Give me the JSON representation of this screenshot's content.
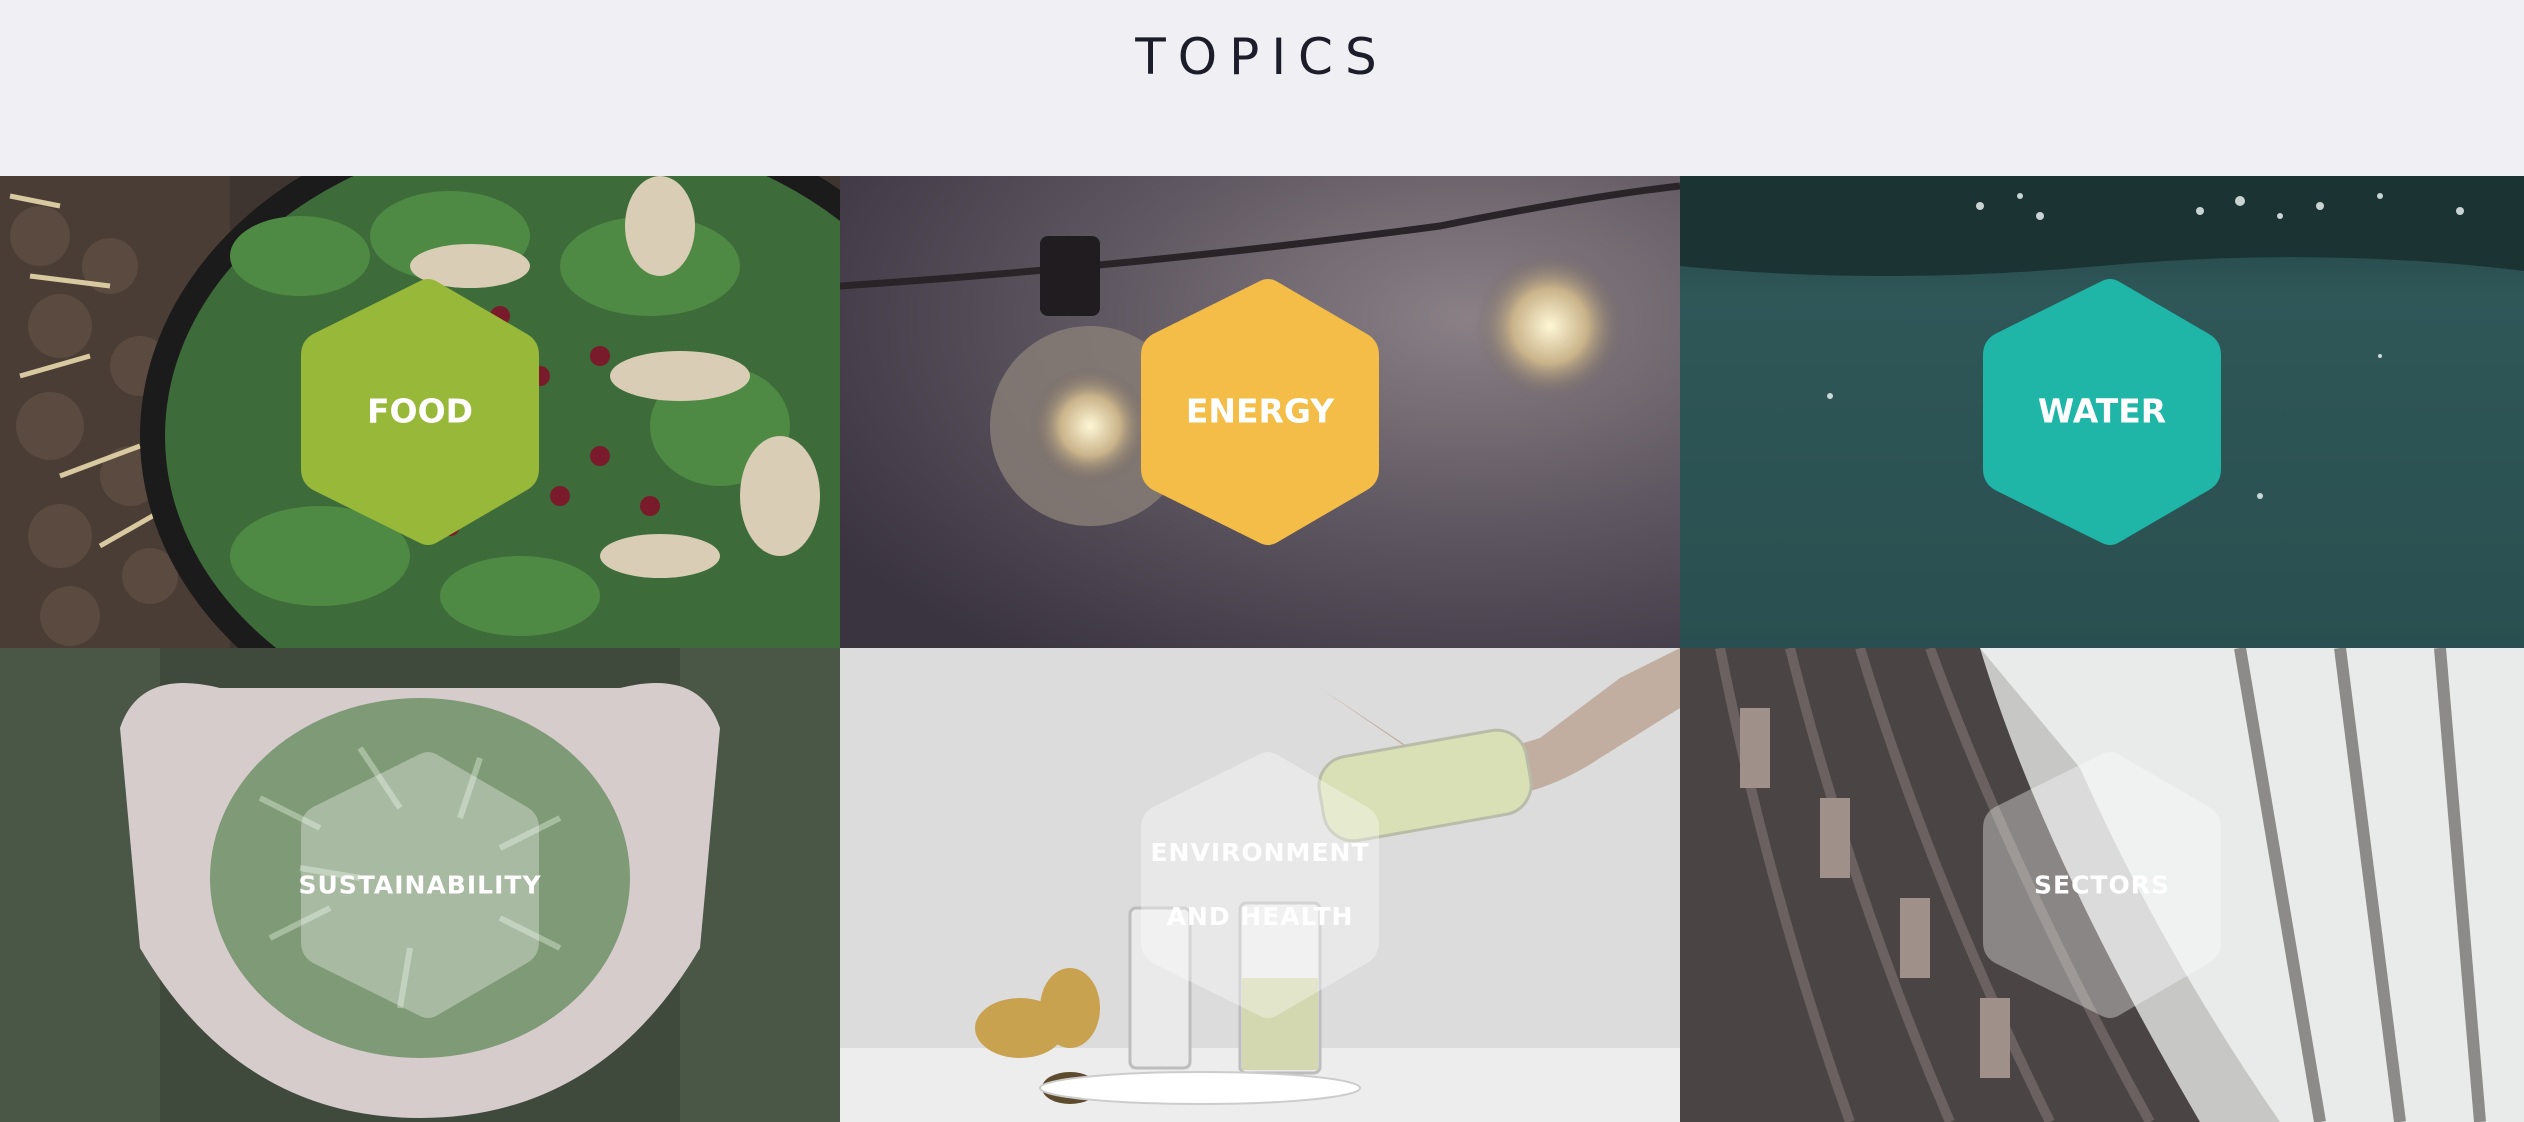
{
  "page": {
    "title": "TOPICS"
  },
  "colors": {
    "background": "#f0f0f4",
    "food_hex": "#98b83a",
    "energy_hex": "#f3bd47",
    "water_hex": "#1fb6a8",
    "muted_hex": "#ffffff"
  },
  "topics": [
    {
      "label": "FOOD",
      "hex_color": "#98b83a",
      "image": "salad-bowl-image"
    },
    {
      "label": "ENERGY",
      "hex_color": "#f3bd47",
      "image": "light-bulb-image"
    },
    {
      "label": "WATER",
      "hex_color": "#1fb6a8",
      "image": "underwater-image"
    },
    {
      "label": "SUSTAINABILITY",
      "hex_color": "#ffffff",
      "image": "hands-pine-needles-image"
    },
    {
      "label": "ENVIRONMENT\nAND HEALTH",
      "hex_color": "#ffffff",
      "image": "pouring-water-image"
    },
    {
      "label": "SECTORS",
      "hex_color": "#ffffff",
      "image": "library-shelves-image"
    }
  ]
}
